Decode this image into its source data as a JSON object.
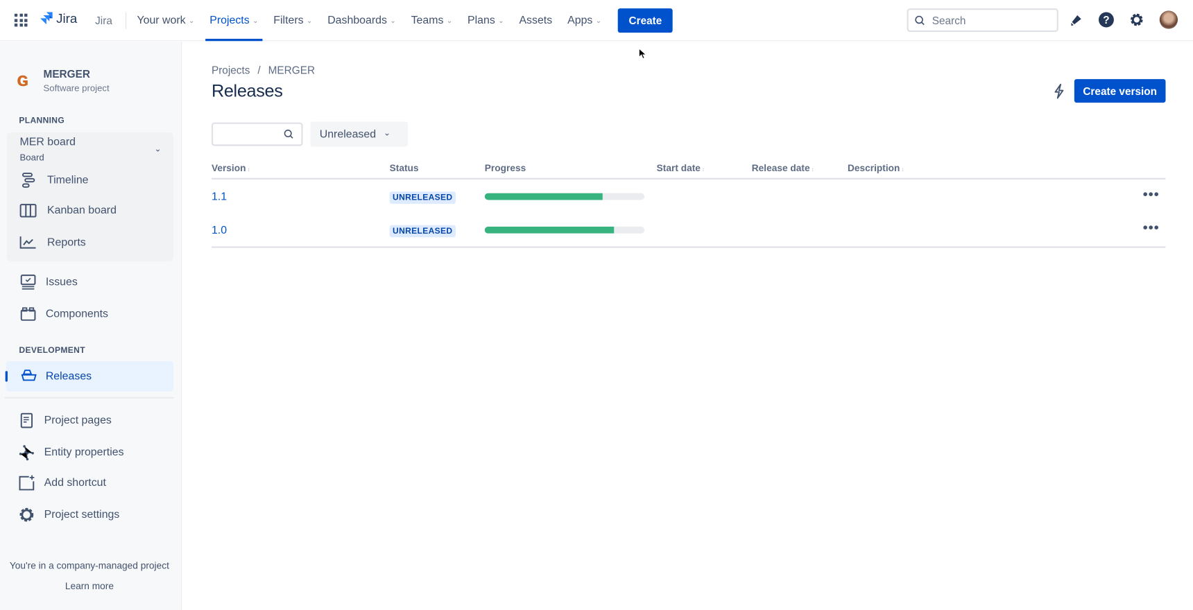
{
  "topnav": {
    "product": "Jira",
    "product_label": "Jira",
    "items": [
      {
        "label": "Your work",
        "chevron": true
      },
      {
        "label": "Projects",
        "chevron": true,
        "active": true
      },
      {
        "label": "Filters",
        "chevron": true
      },
      {
        "label": "Dashboards",
        "chevron": true
      },
      {
        "label": "Teams",
        "chevron": true
      },
      {
        "label": "Plans",
        "chevron": true
      },
      {
        "label": "Assets",
        "chevron": false
      },
      {
        "label": "Apps",
        "chevron": true
      }
    ],
    "create_label": "Create",
    "search_placeholder": "Search",
    "icons": [
      "notifications-icon",
      "help-icon",
      "settings-icon",
      "avatar"
    ]
  },
  "sidebar": {
    "project_name": "MERGER",
    "project_type": "Software project",
    "planning_heading": "PLANNING",
    "board_name": "MER board",
    "board_type": "Board",
    "board_items": [
      {
        "label": "Timeline",
        "icon": "timeline-icon"
      },
      {
        "label": "Kanban board",
        "icon": "kanban-icon"
      },
      {
        "label": "Reports",
        "icon": "reports-icon"
      }
    ],
    "items": [
      {
        "label": "Issues",
        "icon": "issues-icon"
      },
      {
        "label": "Components",
        "icon": "components-icon"
      }
    ],
    "development_heading": "DEVELOPMENT",
    "releases_label": "Releases",
    "bottom_items": [
      {
        "label": "Project pages",
        "icon": "pages-icon"
      },
      {
        "label": "Entity properties",
        "icon": "entity-icon"
      },
      {
        "label": "Add shortcut",
        "icon": "add-shortcut-icon"
      },
      {
        "label": "Project settings",
        "icon": "settings-icon"
      }
    ],
    "footer_text": "You're in a company-managed project",
    "learn_more": "Learn more"
  },
  "main": {
    "breadcrumb": [
      "Projects",
      "/",
      "MERGER"
    ],
    "title": "Releases",
    "create_version_label": "Create version",
    "search_value": "",
    "filter_label": "Unreleased",
    "columns": [
      "Version",
      "Status",
      "Progress",
      "Start date",
      "Release date",
      "Description"
    ],
    "rows": [
      {
        "version": "1.1",
        "status": "UNRELEASED",
        "progress": 0.74,
        "start_date": "",
        "release_date": "",
        "description": ""
      },
      {
        "version": "1.0",
        "status": "UNRELEASED",
        "progress": 0.81,
        "start_date": "",
        "release_date": "",
        "description": ""
      }
    ],
    "more_label": "•••"
  },
  "colors": {
    "primary": "#0052cc",
    "progress": "#36b37e",
    "progress_track": "#ebecf0",
    "lozenge_bg": "#deebff"
  }
}
